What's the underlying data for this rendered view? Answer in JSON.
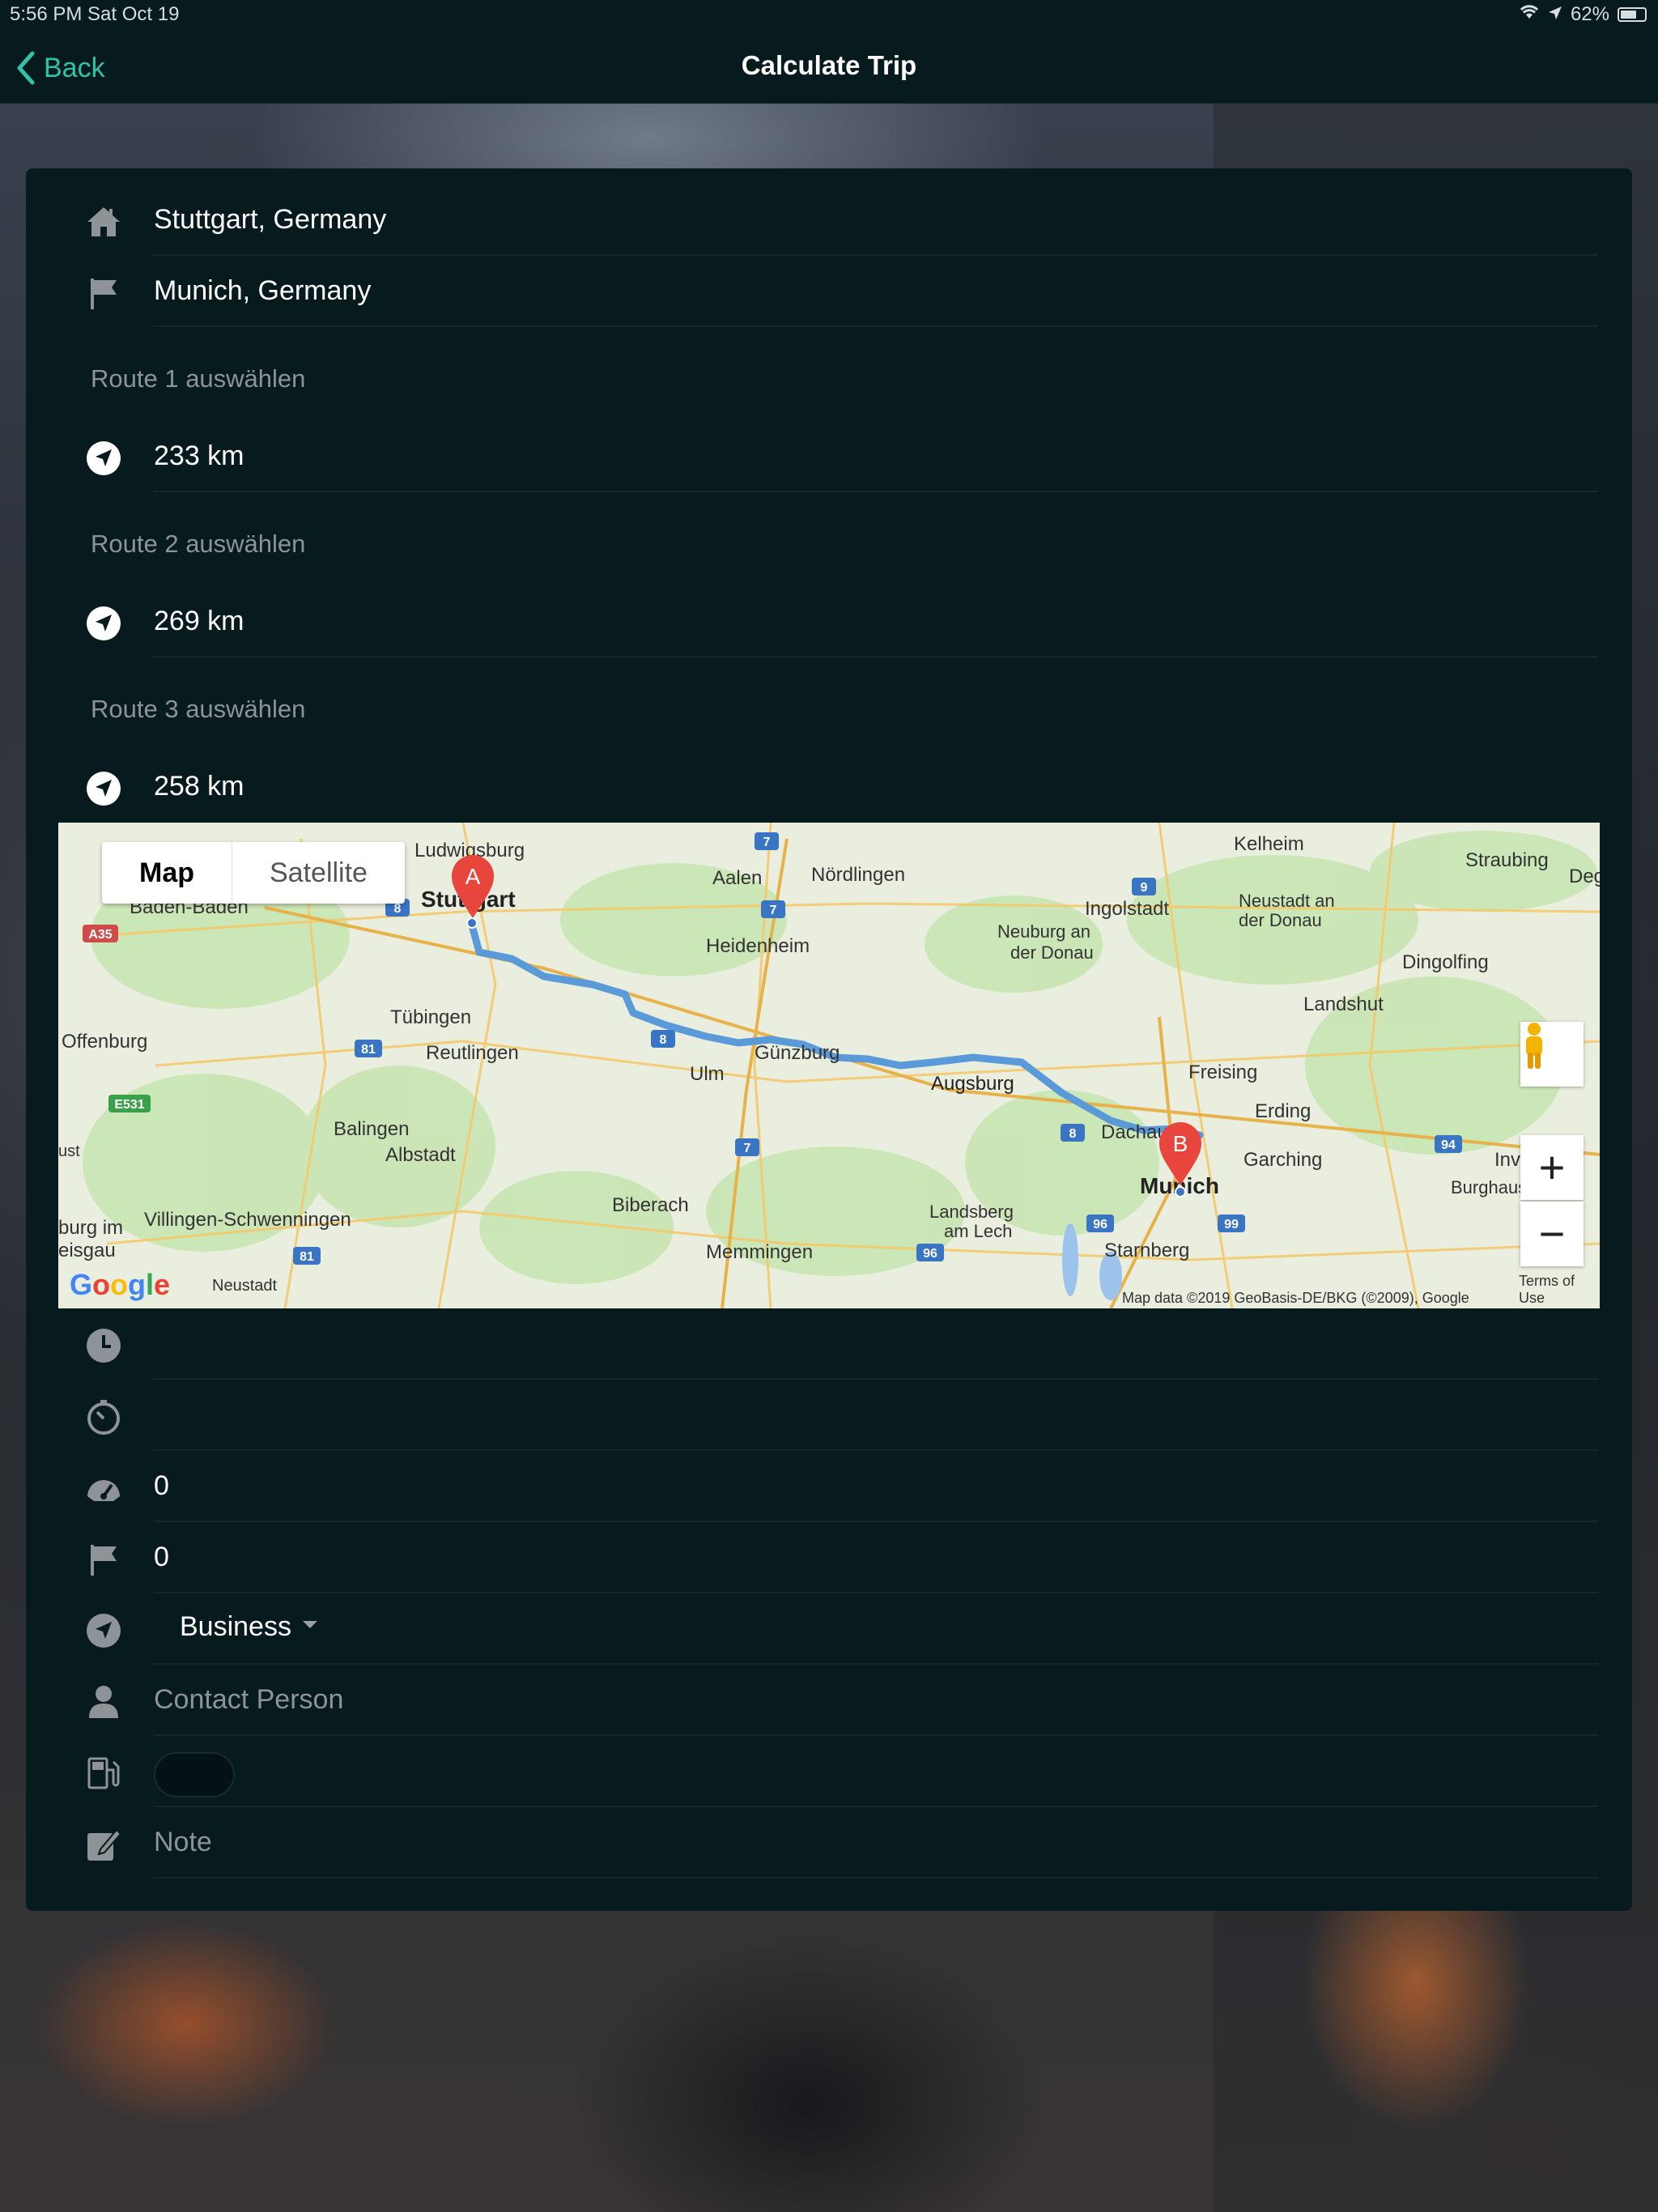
{
  "status_bar": {
    "time": "5:56 PM  Sat Oct 19",
    "battery": "62%"
  },
  "nav": {
    "back_label": "Back",
    "title": "Calculate Trip"
  },
  "trip": {
    "start": "Stuttgart, Germany",
    "destination": "Munich, Germany",
    "routes": [
      {
        "label": "Route 1 auswählen",
        "distance": "233 km"
      },
      {
        "label": "Route 2 auswählen",
        "distance": "269 km"
      },
      {
        "label": "Route 3 auswählen",
        "distance": "258 km"
      }
    ]
  },
  "map": {
    "tab_map": "Map",
    "tab_satellite": "Satellite",
    "zoom_in": "+",
    "zoom_out": "−",
    "credit": "Map data ©2019 GeoBasis-DE/BKG (©2009), Google",
    "terms": "Terms of Use",
    "google": [
      "G",
      "o",
      "o",
      "g",
      "l",
      "e"
    ],
    "marker_a": "A",
    "marker_b": "B",
    "cities": [
      "Ludwigsburg",
      "Stuttgart",
      "Baden-Baden",
      "Aalen",
      "Nördlingen",
      "Heidenheim",
      "Tübingen",
      "Reutlingen",
      "Offenburg",
      "Balingen",
      "Albstadt",
      "Ulm",
      "Günzburg",
      "Augsburg",
      "Ingolstadt",
      "Neuburg an der Donau",
      "Kelheim",
      "Straubing",
      "Deggen",
      "Neustadt an der Donau",
      "Dingolfing",
      "Landshut",
      "Freising",
      "Erding",
      "Dachau",
      "Garching",
      "Munich",
      "Starnberg",
      "Landsberg am Lech",
      "Memmingen",
      "Biberach",
      "Villingen-Schwenningen",
      "burg im eisgau",
      "Neustadt",
      "Burghaus",
      "Inv",
      "ust"
    ],
    "road_badges": [
      "A35",
      "8",
      "7",
      "9",
      "81",
      "8",
      "E531",
      "7",
      "8",
      "96",
      "96",
      "99",
      "94",
      "81"
    ]
  },
  "details": {
    "departure_time": "",
    "duration": "",
    "odometer_start": "0",
    "odometer_end": "0",
    "trip_type": "Business",
    "contact_placeholder": "Contact Person",
    "note_placeholder": "Note"
  },
  "colors": {
    "accent": "#2ec4a8",
    "panel": "#071a1d",
    "route": "#5a9ad9",
    "marker": "#e8453c"
  }
}
